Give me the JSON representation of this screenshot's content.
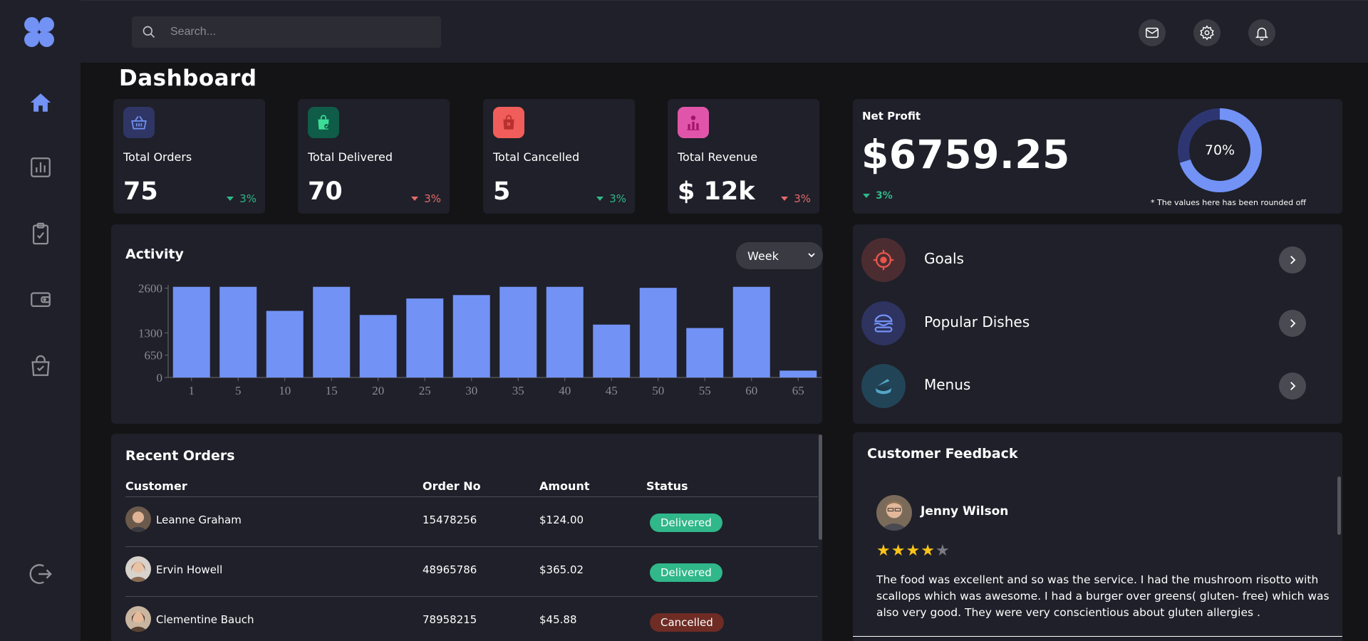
{
  "search": {
    "placeholder": "Search..."
  },
  "page": {
    "title": "Dashboard"
  },
  "colors": {
    "accent": "#7292f5",
    "positive": "#30b78a",
    "negative": "#e56a6a",
    "star": "#fcc419"
  },
  "stats": [
    {
      "label": "Total Orders",
      "value": "75",
      "trend": "3%",
      "direction": "down",
      "trend_color": "#30b78a",
      "icon": "shopping-basket-icon",
      "icon_bg": "#2f3665"
    },
    {
      "label": "Total Delivered",
      "value": "70",
      "trend": "3%",
      "direction": "down",
      "trend_color": "#e56a6a",
      "icon": "shopping-bag-icon",
      "icon_bg": "#0f5c48"
    },
    {
      "label": "Total Cancelled",
      "value": "5",
      "trend": "3%",
      "direction": "down",
      "trend_color": "#30b78a",
      "icon": "cancelled-bag-icon",
      "icon_bg": "#f15d5a"
    },
    {
      "label": "Total Revenue",
      "value": "$ 12k",
      "trend": "3%",
      "direction": "down",
      "trend_color": "#e56a6a",
      "icon": "revenue-chart-icon",
      "icon_bg": "#e055a9"
    }
  ],
  "net_profit": {
    "label": "Net Profit",
    "value": "$6759.25",
    "trend": "3%",
    "percent_label": "70%",
    "percent": 70,
    "note": "* The values here has been rounded off"
  },
  "activity": {
    "title": "Activity",
    "period": {
      "selected": "Week",
      "options": [
        "Week"
      ]
    }
  },
  "chart_data": {
    "type": "bar",
    "categories": [
      "1",
      "5",
      "10",
      "15",
      "20",
      "25",
      "30",
      "35",
      "40",
      "45",
      "50",
      "55",
      "60",
      "65"
    ],
    "values": [
      2640,
      2640,
      1940,
      2640,
      1820,
      2300,
      2400,
      2640,
      2640,
      1540,
      2610,
      1440,
      2640,
      200
    ],
    "ylim": [
      0,
      2800
    ],
    "yticks": [
      0,
      650,
      1300,
      2600
    ],
    "color": "#7292f5",
    "grid": false
  },
  "quick_links": [
    {
      "label": "Goals",
      "icon": "target-icon",
      "icon_bg": "#4b2d31"
    },
    {
      "label": "Popular Dishes",
      "icon": "burger-icon",
      "icon_bg": "#2e3360"
    },
    {
      "label": "Menus",
      "icon": "menu-bowl-icon",
      "icon_bg": "#224457"
    }
  ],
  "recent_orders": {
    "title": "Recent Orders",
    "columns": [
      "Customer",
      "Order No",
      "Amount",
      "Status"
    ],
    "rows": [
      {
        "customer": "Leanne Graham",
        "order_no": "15478256",
        "amount": "$124.00",
        "status": "Delivered"
      },
      {
        "customer": "Ervin Howell",
        "order_no": "48965786",
        "amount": "$365.02",
        "status": "Delivered"
      },
      {
        "customer": "Clementine Bauch",
        "order_no": "78958215",
        "amount": "$45.88",
        "status": "Cancelled"
      }
    ]
  },
  "status_colors": {
    "Delivered": "#30b78a",
    "Cancelled": "#6e2c25"
  },
  "feedback": {
    "title": "Customer Feedback",
    "name": "Jenny Wilson",
    "rating": 4,
    "max_rating": 5,
    "text": "The food was excellent and so was the service. I had the mushroom risotto with scallops which was awesome. I had a burger over greens( gluten- free) which was also very good. They were very conscientious about gluten allergies ."
  }
}
